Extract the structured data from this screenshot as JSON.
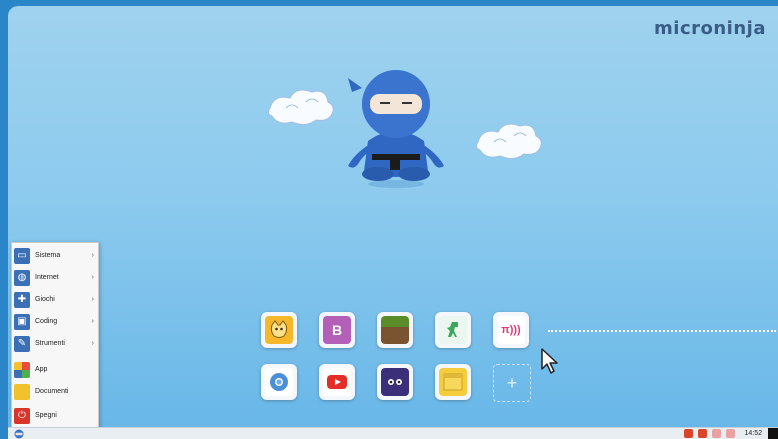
{
  "brand": {
    "name": "microninja"
  },
  "start_menu": {
    "items": [
      {
        "label": "Sistema",
        "icon": "system-icon",
        "color": "#3b6fb6",
        "arrow": "›"
      },
      {
        "label": "Internet",
        "icon": "globe-icon",
        "color": "#3b6fb6",
        "arrow": "›"
      },
      {
        "label": "Giochi",
        "icon": "gamepad-icon",
        "color": "#3b6fb6",
        "arrow": "›"
      },
      {
        "label": "Coding",
        "icon": "monitor-icon",
        "color": "#3b6fb6",
        "arrow": "›"
      },
      {
        "label": "Strumenti",
        "icon": "wrench-icon",
        "color": "#3b6fb6",
        "arrow": "›"
      },
      {
        "label": "App",
        "icon": "apps-grid-icon",
        "color": "#e94b3c",
        "arrow": ""
      },
      {
        "label": "Documenti",
        "icon": "folder-icon",
        "color": "#f2c12e",
        "arrow": ""
      },
      {
        "label": "Spegni",
        "icon": "power-icon",
        "color": "#d9362b",
        "arrow": ""
      }
    ]
  },
  "launcher": {
    "row1": [
      {
        "app": "scratch",
        "icon": "scratch-cat-icon",
        "color": "#f6b82a",
        "glyph": ""
      },
      {
        "app": "bitsbox",
        "icon": "b-block-icon",
        "color": "#b45fb8",
        "glyph": "B"
      },
      {
        "app": "minecraft",
        "icon": "minecraft-block-icon",
        "color": "#5b8c2a",
        "glyph": ""
      },
      {
        "app": "python-dino",
        "icon": "dino-icon",
        "color": "#3aa85b",
        "glyph": ""
      },
      {
        "app": "sonic-pi",
        "icon": "sonic-pi-icon",
        "color": "#e13a7b",
        "glyph": "π)))"
      }
    ],
    "row2": [
      {
        "app": "chromium",
        "icon": "chromium-icon",
        "color": "#4a90d9",
        "glyph": ""
      },
      {
        "app": "youtube",
        "icon": "youtube-icon",
        "color": "#e52d27",
        "glyph": ""
      },
      {
        "app": "monsters",
        "icon": "monster-icon",
        "color": "#3b2f7a",
        "glyph": ""
      },
      {
        "app": "notes",
        "icon": "sticky-note-icon",
        "color": "#f5cc3b",
        "glyph": ""
      }
    ]
  },
  "taskbar": {
    "clock": "14:52",
    "tray": [
      {
        "icon": "printer-icon",
        "color": "#d9452b"
      },
      {
        "icon": "camera-icon",
        "color": "#d9452b"
      },
      {
        "icon": "network-icon",
        "color": "#e9a2a2"
      },
      {
        "icon": "volume-icon",
        "color": "#e9a2a2"
      }
    ]
  }
}
